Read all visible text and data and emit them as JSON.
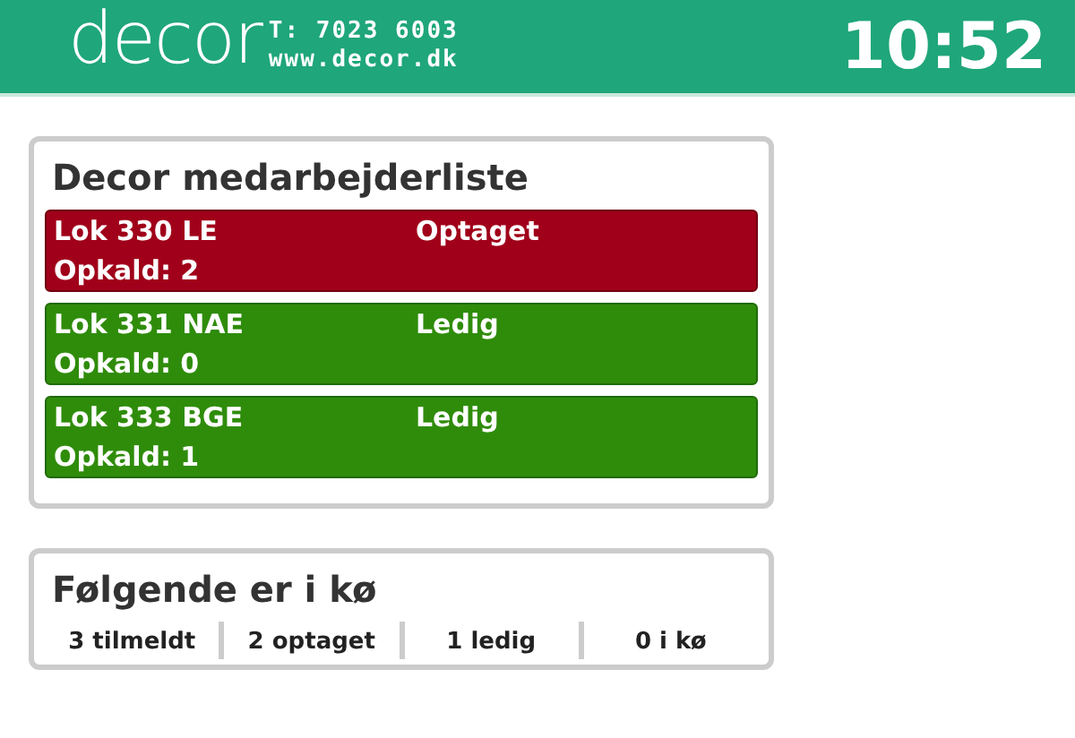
{
  "header": {
    "logo": "decor",
    "phone": "T: 7023 6003",
    "website": "www.decor.dk",
    "clock": "10:52"
  },
  "staff_list": {
    "title": "Decor medarbejderliste",
    "rows": [
      {
        "name": "Lok 330 LE",
        "status": "Optaget",
        "kind": "busy",
        "calls": "Opkald: 2"
      },
      {
        "name": "Lok 331 NAE",
        "status": "Ledig",
        "kind": "free",
        "calls": "Opkald: 0"
      },
      {
        "name": "Lok 333 BGE",
        "status": "Ledig",
        "kind": "free",
        "calls": "Opkald: 1"
      }
    ]
  },
  "queue": {
    "title": "Følgende er i kø",
    "stats": [
      "3 tilmeldt",
      "2 optaget",
      "1 ledig",
      "0 i kø"
    ]
  }
}
